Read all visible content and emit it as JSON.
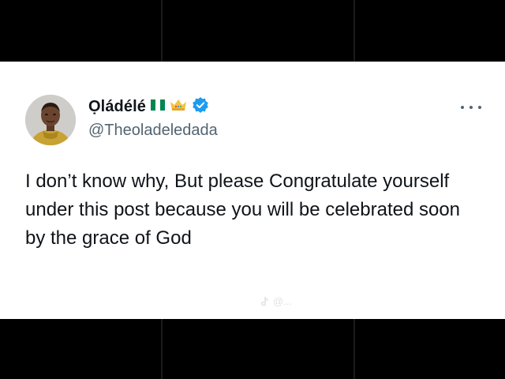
{
  "tweet": {
    "display_name": "Ọládélé",
    "handle": "@Theoladeledada",
    "text": "I don’t know why, But please Congratulate yourself under this post because you will be celebrated soon by the grace of God",
    "badges": [
      "nigeria-flag-icon",
      "crown-icon",
      "verified-badge-icon"
    ],
    "verified_color": "#1d9bf0"
  },
  "watermark": {
    "text": "@..."
  },
  "colors": {
    "background_bars": "#000000",
    "card": "#ffffff",
    "primary_text": "#0f1419",
    "secondary_text": "#536471",
    "flag_green": "#008751"
  }
}
